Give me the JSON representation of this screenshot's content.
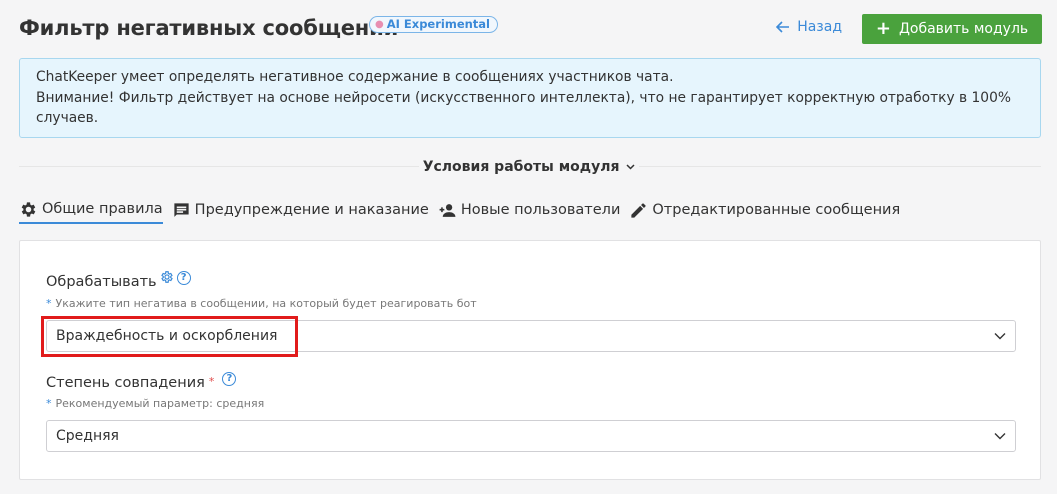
{
  "header": {
    "title": "Фильтр негативных сообщений",
    "badge": "AI Experimental",
    "back_label": "Назад",
    "add_label": "Добавить модуль"
  },
  "info": {
    "lines": [
      "ChatKeeper умеет определять негативное содержание в сообщениях участников чата.",
      "Внимание! Фильтр действует на основе нейросети (искусственного интеллекта), что не гарантирует корректную отработку в 100% случаев."
    ]
  },
  "conditions": {
    "label": "Условия работы модуля"
  },
  "tabs": [
    {
      "label": "Общие правила",
      "icon": "gear-icon",
      "active": true
    },
    {
      "label": "Предупреждение и наказание",
      "icon": "message-icon",
      "active": false
    },
    {
      "label": "Новые пользователи",
      "icon": "add-user-icon",
      "active": false
    },
    {
      "label": "Отредактированные сообщения",
      "icon": "pencil-icon",
      "active": false
    }
  ],
  "form": {
    "process": {
      "label": "Обрабатывать",
      "hint": "Укажите тип негатива в сообщении, на который будет реагировать бот",
      "value": "Враждебность и оскорбления"
    },
    "match": {
      "label": "Степень совпадения",
      "required_mark": "*",
      "hint": "Рекомендуемый параметр: средняя",
      "value": "Средняя"
    }
  },
  "colors": {
    "accent": "#3b8ad8",
    "primary_button": "#4aa23d",
    "highlight": "#e11b1b"
  }
}
